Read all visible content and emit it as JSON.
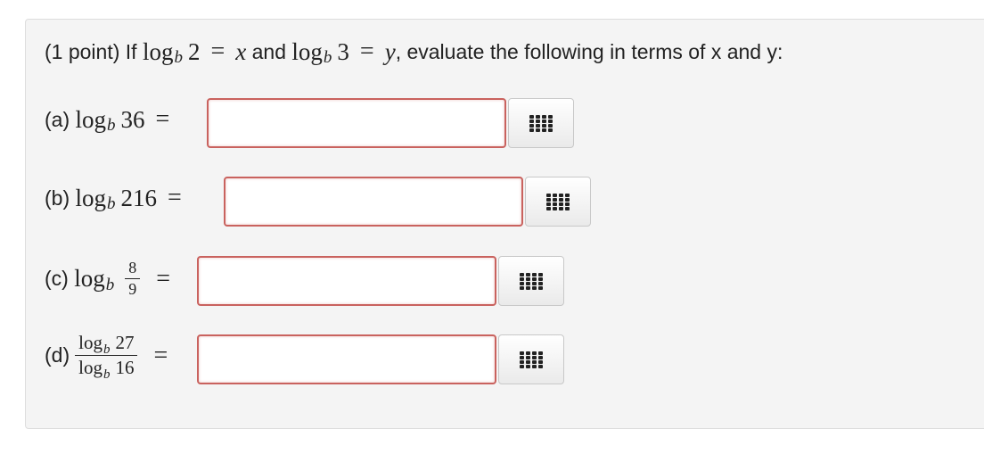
{
  "problem": {
    "points": "(1 point)",
    "if_word": "If",
    "log": "log",
    "base": "b",
    "arg1": "2",
    "eq": "=",
    "var_x": "x",
    "and_word": "and",
    "arg2": "3",
    "var_y": "y",
    "tail": ", evaluate the following in terms of x and y:"
  },
  "parts": [
    {
      "label": "(a)",
      "log": "log",
      "base": "b",
      "arg": "36",
      "eq": "=",
      "value": ""
    },
    {
      "label": "(b)",
      "log": "log",
      "base": "b",
      "arg": "216",
      "eq": "=",
      "value": ""
    },
    {
      "label": "(c)",
      "log": "log",
      "base": "b",
      "num": "8",
      "den": "9",
      "eq": "=",
      "value": ""
    },
    {
      "label": "(d)",
      "num_log": "log",
      "num_base": "b",
      "num_arg": "27",
      "den_log": "log",
      "den_base": "b",
      "den_arg": "16",
      "eq": "=",
      "value": ""
    }
  ],
  "palette_icon": "equation-palette-icon"
}
